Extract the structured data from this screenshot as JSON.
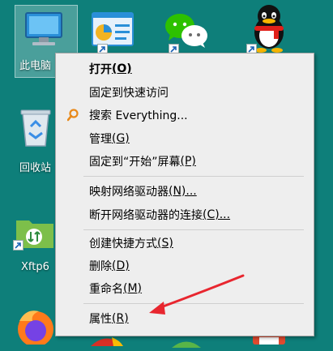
{
  "desktop": {
    "icons": [
      {
        "id": "this-pc",
        "label": "此电脑"
      },
      {
        "id": "recycle-bin",
        "label": "回收站"
      },
      {
        "id": "xftp",
        "label": "Xftp6"
      }
    ]
  },
  "context_menu": {
    "items": [
      {
        "label": "打开",
        "shortcut": "(O)"
      },
      {
        "label": "固定到快速访问",
        "shortcut": ""
      },
      {
        "label": "搜索 Everything...",
        "shortcut": ""
      },
      {
        "label": "管理",
        "shortcut": "(G)"
      },
      {
        "label": "固定到“开始”屏幕",
        "shortcut": "(P)"
      },
      {
        "label": "映射网络驱动器",
        "shortcut": "(N)..."
      },
      {
        "label": "断开网络驱动器的连接",
        "shortcut": "(C)..."
      },
      {
        "label": "创建快捷方式",
        "shortcut": "(S)"
      },
      {
        "label": "删除",
        "shortcut": "(D)"
      },
      {
        "label": "重命名",
        "shortcut": "(M)"
      },
      {
        "label": "属性",
        "shortcut": "(R)"
      }
    ]
  },
  "colors": {
    "desktop_bg": "#0e7f7a",
    "menu_bg": "#eeeeee",
    "annotation_arrow": "#e8262f"
  }
}
